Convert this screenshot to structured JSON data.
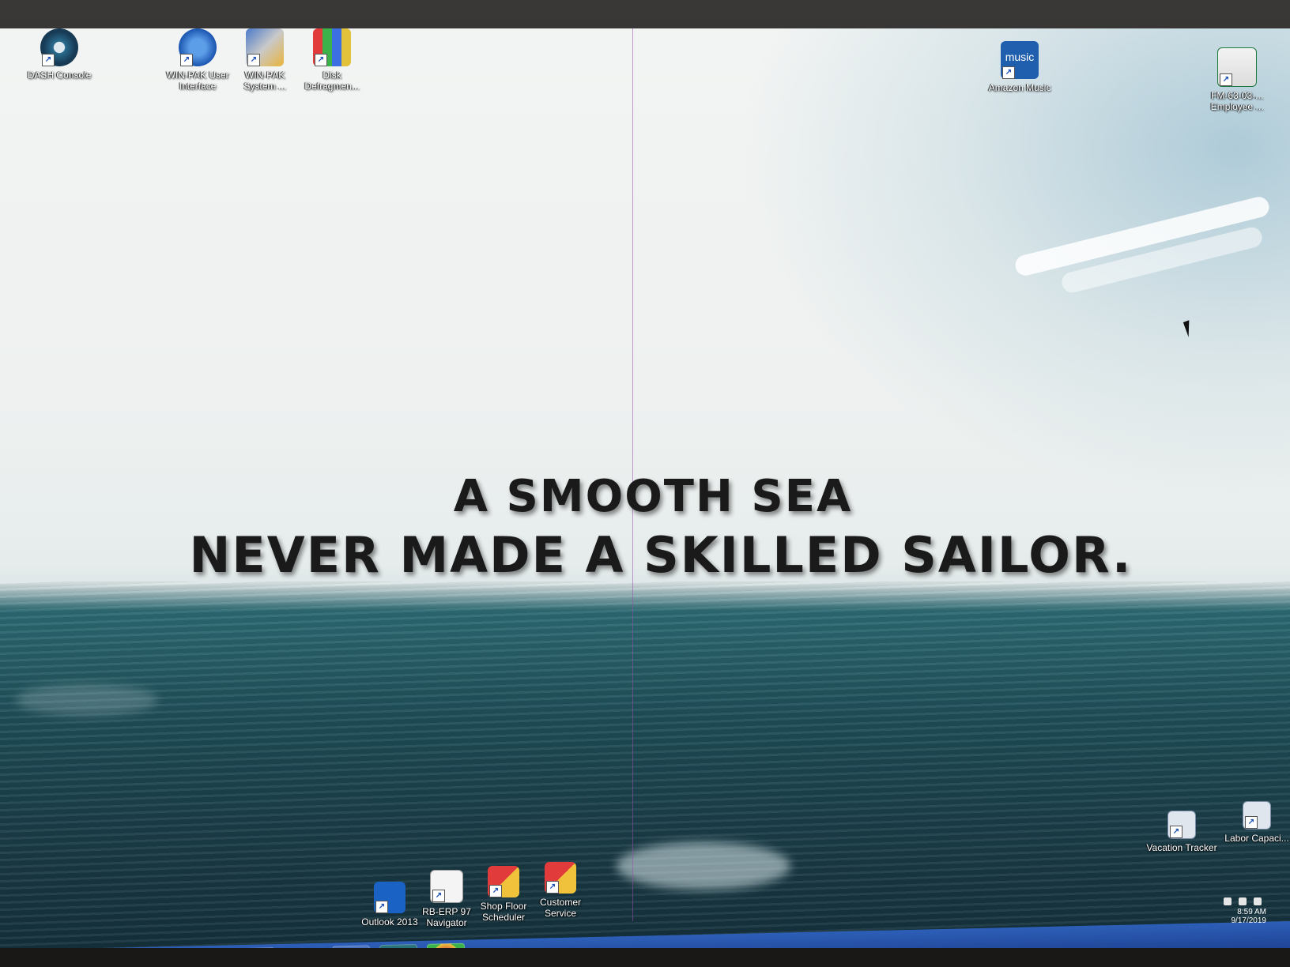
{
  "quote": {
    "line1": "A SMOOTH SEA",
    "line2": "NEVER MADE A SKILLED SAILOR."
  },
  "desktop_icons_top": [
    {
      "label": "DASH Console",
      "icon": "dash-console-icon"
    },
    {
      "label": "WIN-PAK User Interface",
      "icon": "winpak-ui-icon"
    },
    {
      "label": "WIN-PAK System ...",
      "icon": "winpak-system-icon"
    },
    {
      "label": "Disk Defragmen...",
      "icon": "disk-defrag-icon"
    },
    {
      "label": "Amazon Music",
      "icon": "amazon-music-icon",
      "badge": "music"
    },
    {
      "label": "FM-63-03-... Employee ...",
      "icon": "excel-file-icon"
    }
  ],
  "desktop_icons_bottom": [
    {
      "label": "Outlook 2013",
      "icon": "outlook-icon"
    },
    {
      "label": "RB-ERP 97 Navigator",
      "icon": "rb-erp-icon"
    },
    {
      "label": "Shop Floor Scheduler",
      "icon": "shop-floor-icon"
    },
    {
      "label": "Customer Service",
      "icon": "customer-service-icon"
    }
  ],
  "desktop_icons_right": [
    {
      "label": "Vacation Tracker",
      "icon": "vacation-tracker-icon"
    },
    {
      "label": "Labor Capaci...",
      "icon": "labor-capacity-icon"
    }
  ],
  "tray": {
    "time": "8:59 AM",
    "date": "9/17/2019"
  },
  "colors": {
    "taskbar": "#2d5fb8",
    "sea": "#1f4d57",
    "sky": "#eef1f0"
  }
}
